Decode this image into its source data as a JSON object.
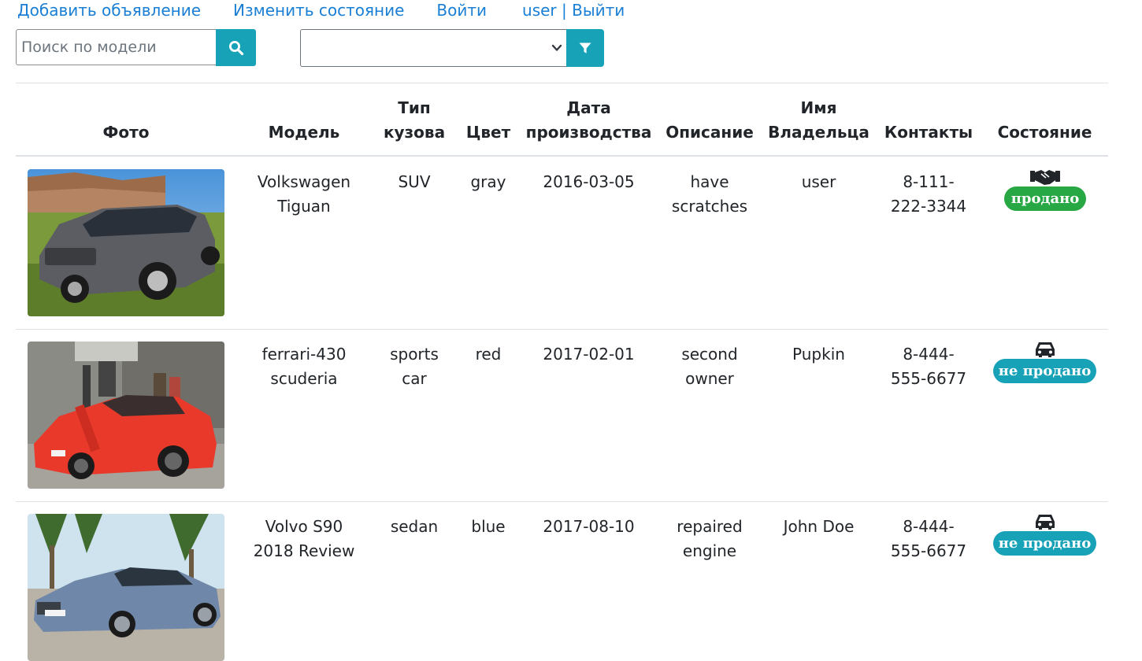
{
  "nav": {
    "add_ad": "Добавить объявление",
    "change_state": "Изменить состояние",
    "login": "Войти",
    "user_logout": "user | Выйти"
  },
  "search": {
    "placeholder": "Поиск по модели",
    "icon": "search-icon"
  },
  "filter": {
    "selected": "",
    "icon": "filter-icon"
  },
  "colors": {
    "link": "#1a7fd4",
    "accent": "#17a2b8",
    "sold": "#28a745"
  },
  "table": {
    "headers": {
      "photo": "Фото",
      "model": "Модель",
      "body_type_1": "Тип",
      "body_type_2": "кузова",
      "color": "Цвет",
      "date_1": "Дата",
      "date_2": "производства",
      "description": "Описание",
      "owner_1": "Имя",
      "owner_2": "Владельца",
      "contacts": "Контакты",
      "state": "Состояние"
    },
    "rows": [
      {
        "model_1": "Volkswagen",
        "model_2": "Tiguan",
        "body_1": "SUV",
        "body_2": "",
        "color": "gray",
        "date": "2016-03-05",
        "desc_1": "have",
        "desc_2": "scratches",
        "owner": "user",
        "contact_1": "8-111-",
        "contact_2": "222-3344",
        "state_icon": "handshake-icon",
        "state": "продано"
      },
      {
        "model_1": "ferrari-430",
        "model_2": "scuderia",
        "body_1": "sports",
        "body_2": "car",
        "color": "red",
        "date": "2017-02-01",
        "desc_1": "second",
        "desc_2": "owner",
        "owner": "Pupkin",
        "contact_1": "8-444-",
        "contact_2": "555-6677",
        "state_icon": "car-icon",
        "state": "не продано"
      },
      {
        "model_1": "Volvo S90",
        "model_2": "2018 Review",
        "body_1": "sedan",
        "body_2": "",
        "color": "blue",
        "date": "2017-08-10",
        "desc_1": "repaired",
        "desc_2": "engine",
        "owner": "John Doe",
        "contact_1": "8-444-",
        "contact_2": "555-6677",
        "state_icon": "car-icon",
        "state": "не продано"
      }
    ]
  }
}
